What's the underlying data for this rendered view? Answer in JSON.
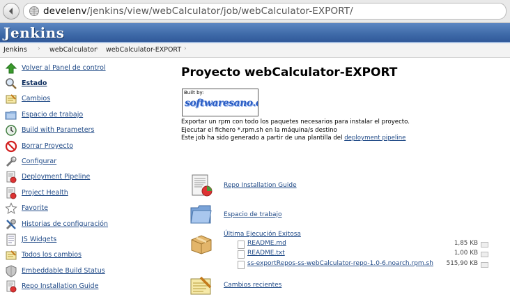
{
  "browser": {
    "url_host": "develenv",
    "url_path": "/jenkins/view/webCalculator/job/webCalculator-EXPORT/"
  },
  "header": {
    "logo": "Jenkins"
  },
  "breadcrumbs": [
    "Jenkins",
    "webCalculator",
    "webCalculator-EXPORT"
  ],
  "sidebar": {
    "items": [
      {
        "label": "Volver al Panel de control",
        "icon": "up-arrow-icon"
      },
      {
        "label": "Estado",
        "icon": "search-icon",
        "active": true
      },
      {
        "label": "Cambios",
        "icon": "notepad-icon"
      },
      {
        "label": "Espacio de trabajo",
        "icon": "folder-icon"
      },
      {
        "label": "Build with Parameters",
        "icon": "clock-icon"
      },
      {
        "label": "Borrar Proyecto",
        "icon": "no-entry-icon"
      },
      {
        "label": "Configurar",
        "icon": "wrench-icon"
      },
      {
        "label": "Deployment Pipeline",
        "icon": "report-icon"
      },
      {
        "label": "Project Health",
        "icon": "report-icon"
      },
      {
        "label": "Favorite",
        "icon": "star-icon"
      },
      {
        "label": "Historias de configuración",
        "icon": "tools-icon"
      },
      {
        "label": "JS Widgets",
        "icon": "document-icon"
      },
      {
        "label": "Todos los cambios",
        "icon": "notepad-icon"
      },
      {
        "label": "Embeddable Build Status",
        "icon": "shield-icon"
      },
      {
        "label": "Repo Installation Guide",
        "icon": "report-icon"
      }
    ]
  },
  "main": {
    "title": "Proyecto webCalculator-EXPORT",
    "badge": {
      "top": "Built by:",
      "main": "softwaresano.com"
    },
    "description": {
      "line1": "Exportar un rpm con todo los paquetes necesarios para instalar el proyecto.",
      "line2": "Ejecutar el fichero *.rpm.sh en la máquina/s destino",
      "line3_prefix": "Este job ha sido generado a partir de una plantilla del ",
      "line3_link": "deployment pipeline"
    },
    "sections": {
      "repo_guide": "Repo Installation Guide",
      "workspace": "Espacio de trabajo",
      "last_success": "Última Ejecución Exitosa",
      "recent_changes": "Cambios recientes"
    },
    "artifacts": [
      {
        "name": "README.md",
        "size": "1,85 KB"
      },
      {
        "name": "README.txt",
        "size": "1,00 KB"
      },
      {
        "name": "ss-exportRepos-ss-webCalculator-repo-1.0-6.noarch.rpm.sh",
        "size": "515,90 KB"
      }
    ]
  },
  "colors": {
    "header": "#3e6aa8",
    "link": "#204a87"
  }
}
